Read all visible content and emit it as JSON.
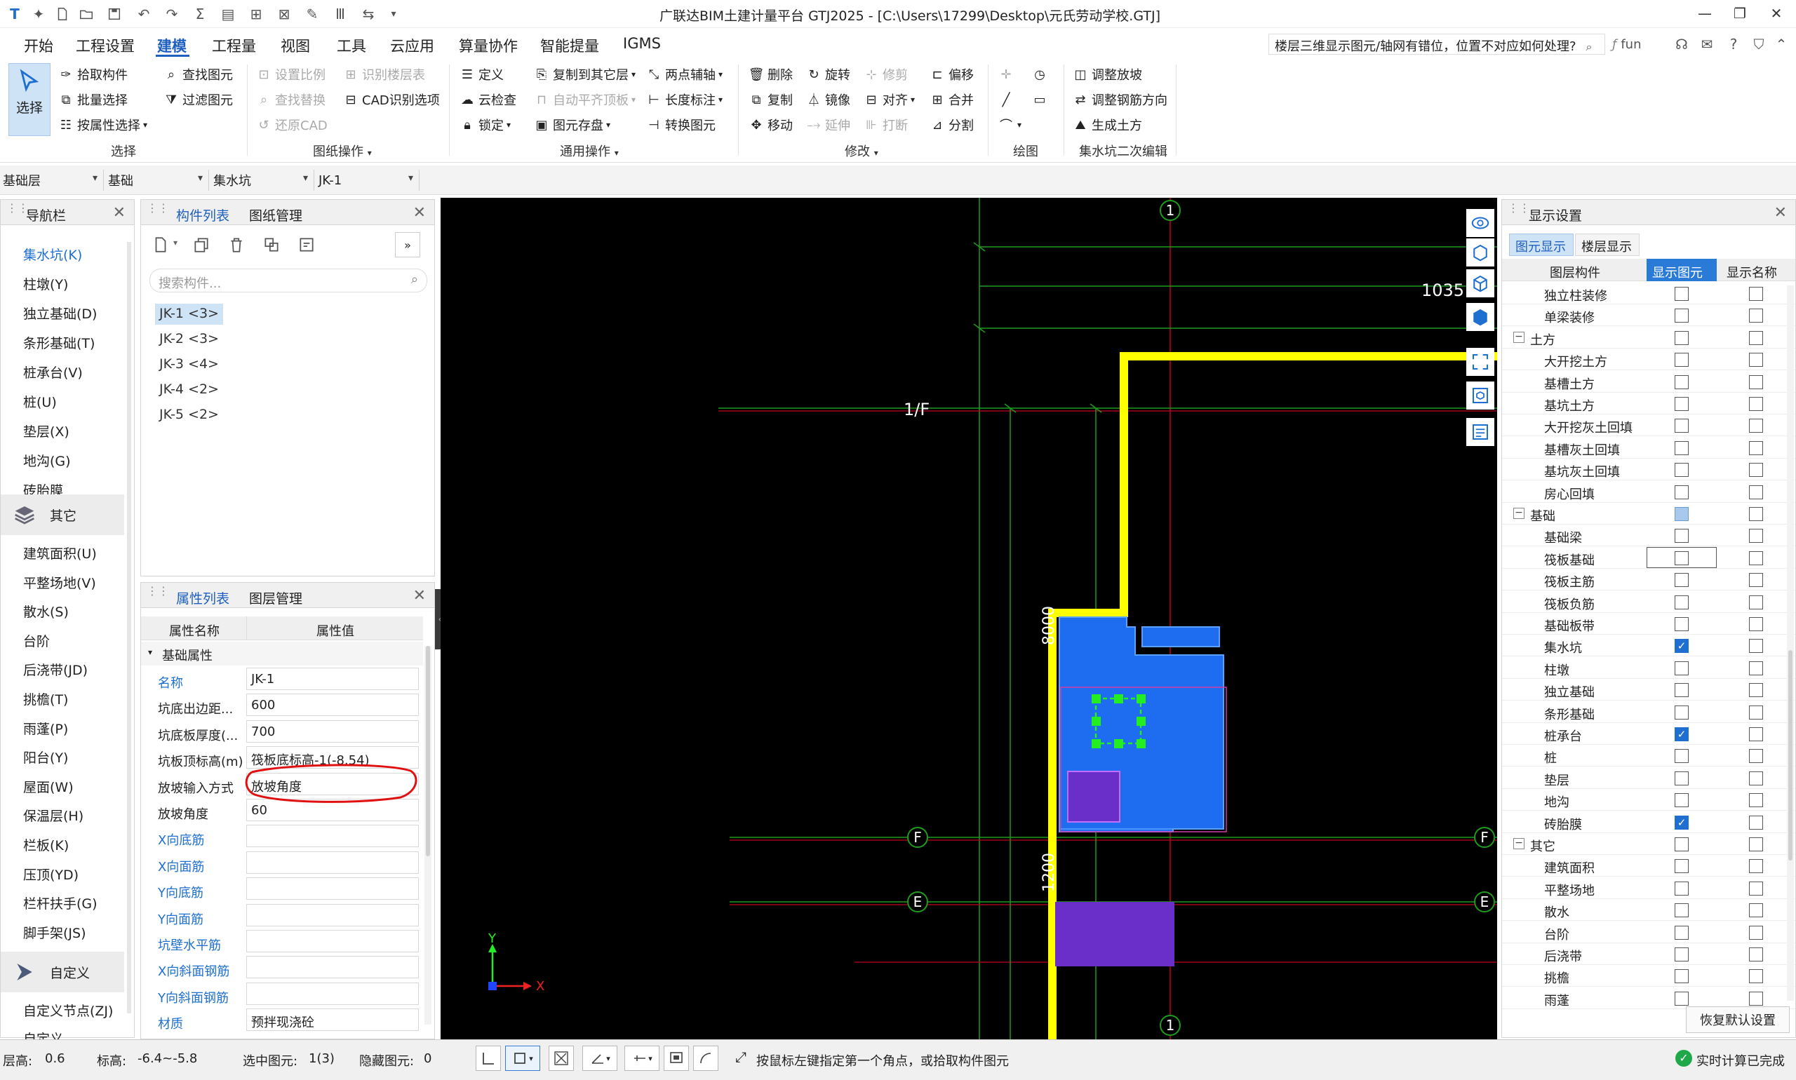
{
  "title": "广联达BIM土建计量平台 GTJ2025 - [C:\\Users\\17299\\Desktop\\元氏劳动学校.GTJ]",
  "menu": {
    "items": [
      "开始",
      "工程设置",
      "建模",
      "工程量",
      "视图",
      "工具",
      "云应用",
      "算量协作",
      "智能提量",
      "IGMS"
    ],
    "help_text": "楼层三维显示图元/轴网有错位，位置不对应如何处理?",
    "user": "fun"
  },
  "ribbon": {
    "select_label": "选择",
    "pick_component": "拾取构件",
    "batch_select": "批量选择",
    "by_attr_select": "按属性选择",
    "find_element": "查找图元",
    "filter_element": "过滤图元",
    "group_select": "选择",
    "set_scale": "设置比例",
    "identify_floor_table": "识别楼层表",
    "find_replace": "查找替换",
    "cad_options": "CAD识别选项",
    "restore_cad": "还原CAD",
    "group_drawing": "图纸操作",
    "define": "定义",
    "copy_to_other": "复制到其它层",
    "two_point_axis": "两点辅轴",
    "cloud_check": "云检查",
    "auto_flat_roof": "自动平齐顶板",
    "length_mark": "长度标注",
    "lock": "锁定",
    "element_save": "图元存盘",
    "convert_element": "转换图元",
    "group_general": "通用操作",
    "delete": "删除",
    "rotate": "旋转",
    "trim": "修剪",
    "offset": "偏移",
    "copy": "复制",
    "mirror": "镜像",
    "align": "对齐",
    "merge": "合并",
    "move": "移动",
    "extend": "延伸",
    "break": "打断",
    "split": "分割",
    "group_modify": "修改",
    "group_draw": "绘图",
    "adjust_slope": "调整放坡",
    "adjust_rebar_dir": "调整钢筋方向",
    "gen_earthwork": "生成土方",
    "group_sump_edit": "集水坑二次编辑"
  },
  "layerbar": [
    "基础层",
    "基础",
    "集水坑",
    "JK-1"
  ],
  "nav": {
    "title": "导航栏",
    "items_top": [
      "集水坑(K)",
      "柱墩(Y)",
      "独立基础(D)",
      "条形基础(T)",
      "桩承台(V)",
      "桩(U)",
      "垫层(X)",
      "地沟(G)",
      "砖胎膜"
    ],
    "section_other": "其它",
    "items_other": [
      "建筑面积(U)",
      "平整场地(V)",
      "散水(S)",
      "台阶",
      "后浇带(JD)",
      "挑檐(T)",
      "雨蓬(P)",
      "阳台(Y)",
      "屋面(W)",
      "保温层(H)",
      "栏板(K)",
      "压顶(YD)",
      "栏杆扶手(G)",
      "脚手架(JS)"
    ],
    "section_custom": "自定义",
    "items_custom": [
      "自定义节点(ZJ)",
      "自定义..."
    ]
  },
  "component_panel": {
    "tab1": "构件列表",
    "tab2": "图纸管理",
    "search_placeholder": "搜索构件...",
    "items": [
      "JK-1 <3>",
      "JK-2 <3>",
      "JK-3 <4>",
      "JK-4 <2>",
      "JK-5 <2>"
    ]
  },
  "property_panel": {
    "tab1": "属性列表",
    "tab2": "图层管理",
    "col_name": "属性名称",
    "col_value": "属性值",
    "section": "基础属性",
    "rows": [
      {
        "name": "名称",
        "value": "JK-1"
      },
      {
        "name": "坑底出边距...",
        "value": "600"
      },
      {
        "name": "坑底板厚度(...",
        "value": "700"
      },
      {
        "name": "坑板顶标高(m)",
        "value": "筏板底标高-1(-8.54)"
      },
      {
        "name": "放坡输入方式",
        "value": "放坡角度"
      },
      {
        "name": "放坡角度",
        "value": "60"
      },
      {
        "name": "X向底筋",
        "value": ""
      },
      {
        "name": "X向面筋",
        "value": ""
      },
      {
        "name": "Y向底筋",
        "value": ""
      },
      {
        "name": "Y向面筋",
        "value": ""
      },
      {
        "name": "坑壁水平筋",
        "value": ""
      },
      {
        "name": "X向斜面钢筋",
        "value": ""
      },
      {
        "name": "Y向斜面钢筋",
        "value": ""
      },
      {
        "name": "材质",
        "value": "预拌现浇砼"
      }
    ]
  },
  "canvas": {
    "axis_1_top": "1",
    "axis_1_bottom": "1",
    "axis_1f": "1/F",
    "axis_f_left": "F",
    "axis_f_right": "F",
    "axis_e_left": "E",
    "axis_e_right": "E",
    "dim_1035": "1035",
    "dim_8000": "8000",
    "dim_1200": "1200",
    "coord_x": "X",
    "coord_y": "Y"
  },
  "display_settings": {
    "title": "显示设置",
    "tab1": "图元显示",
    "tab2": "楼层显示",
    "col_component": "图层构件",
    "col_show": "显示图元",
    "col_name": "显示名称",
    "rows": [
      {
        "label": "独立柱装修",
        "level": 2,
        "show": false,
        "name": false
      },
      {
        "label": "单梁装修",
        "level": 2,
        "show": false,
        "name": false
      },
      {
        "label": "土方",
        "level": 1,
        "show": false,
        "name": false
      },
      {
        "label": "大开挖土方",
        "level": 2,
        "show": false,
        "name": false
      },
      {
        "label": "基槽土方",
        "level": 2,
        "show": false,
        "name": false
      },
      {
        "label": "基坑土方",
        "level": 2,
        "show": false,
        "name": false
      },
      {
        "label": "大开挖灰土回填",
        "level": 2,
        "show": false,
        "name": false
      },
      {
        "label": "基槽灰土回填",
        "level": 2,
        "show": false,
        "name": false
      },
      {
        "label": "基坑灰土回填",
        "level": 2,
        "show": false,
        "name": false
      },
      {
        "label": "房心回填",
        "level": 2,
        "show": false,
        "name": false
      },
      {
        "label": "基础",
        "level": 1,
        "show": "partial",
        "name": false
      },
      {
        "label": "基础梁",
        "level": 2,
        "show": false,
        "name": false
      },
      {
        "label": "筏板基础",
        "level": 2,
        "show": false,
        "name": false
      },
      {
        "label": "筏板主筋",
        "level": 2,
        "show": false,
        "name": false
      },
      {
        "label": "筏板负筋",
        "level": 2,
        "show": false,
        "name": false
      },
      {
        "label": "基础板带",
        "level": 2,
        "show": false,
        "name": false
      },
      {
        "label": "集水坑",
        "level": 2,
        "show": true,
        "name": false
      },
      {
        "label": "柱墩",
        "level": 2,
        "show": false,
        "name": false
      },
      {
        "label": "独立基础",
        "level": 2,
        "show": false,
        "name": false
      },
      {
        "label": "条形基础",
        "level": 2,
        "show": false,
        "name": false
      },
      {
        "label": "桩承台",
        "level": 2,
        "show": true,
        "name": false
      },
      {
        "label": "桩",
        "level": 2,
        "show": false,
        "name": false
      },
      {
        "label": "垫层",
        "level": 2,
        "show": false,
        "name": false
      },
      {
        "label": "地沟",
        "level": 2,
        "show": false,
        "name": false
      },
      {
        "label": "砖胎膜",
        "level": 2,
        "show": true,
        "name": false
      },
      {
        "label": "其它",
        "level": 1,
        "show": false,
        "name": false
      },
      {
        "label": "建筑面积",
        "level": 2,
        "show": false,
        "name": false
      },
      {
        "label": "平整场地",
        "level": 2,
        "show": false,
        "name": false
      },
      {
        "label": "散水",
        "level": 2,
        "show": false,
        "name": false
      },
      {
        "label": "台阶",
        "level": 2,
        "show": false,
        "name": false
      },
      {
        "label": "后浇带",
        "level": 2,
        "show": false,
        "name": false
      },
      {
        "label": "挑檐",
        "level": 2,
        "show": false,
        "name": false
      },
      {
        "label": "雨蓬",
        "level": 2,
        "show": false,
        "name": false
      }
    ],
    "restore_default": "恢复默认设置"
  },
  "status": {
    "floor_height_label": "层高:",
    "floor_height": "0.6",
    "elevation_label": "标高:",
    "elevation": "-6.4~-5.8",
    "selected_label": "选中图元:",
    "selected": "1(3)",
    "hidden_label": "隐藏图元:",
    "hidden": "0",
    "hint": "按鼠标左键指定第一个角点，或拾取构件图元",
    "realtime": "实时计算已完成"
  },
  "colors": {
    "accent": "#1f5fbf",
    "sump_blue": "#1e6cf0",
    "sump_purple": "#6a2fc8",
    "yellow_wall": "#ffff00",
    "axis_green": "#1e9a1e",
    "axis_red": "#c0001e",
    "highlight_red": "#e01010"
  }
}
